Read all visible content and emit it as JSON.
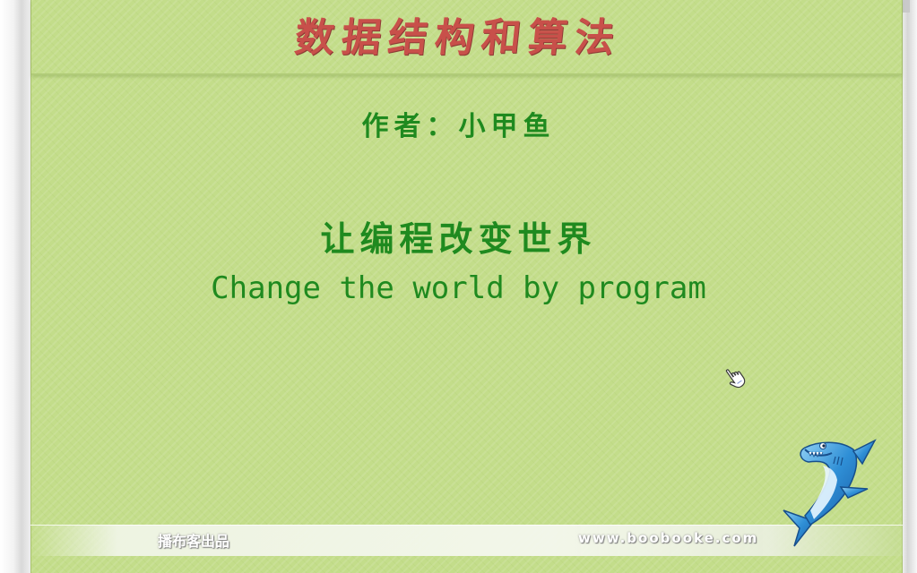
{
  "slide": {
    "title": "数据结构和算法",
    "author": "作者：小甲鱼",
    "slogan_cn": "让编程改变世界",
    "slogan_en": "Change the world by program"
  },
  "footer": {
    "left_text": "播布客出品",
    "right_text": "www.boobooke.com"
  },
  "icons": {
    "cursor": "hand-pointer-icon",
    "mascot": "shark-mascot-icon"
  },
  "colors": {
    "background": "#c3dd8a",
    "title": "#c8504a",
    "text_green": "#1f8a1f"
  }
}
